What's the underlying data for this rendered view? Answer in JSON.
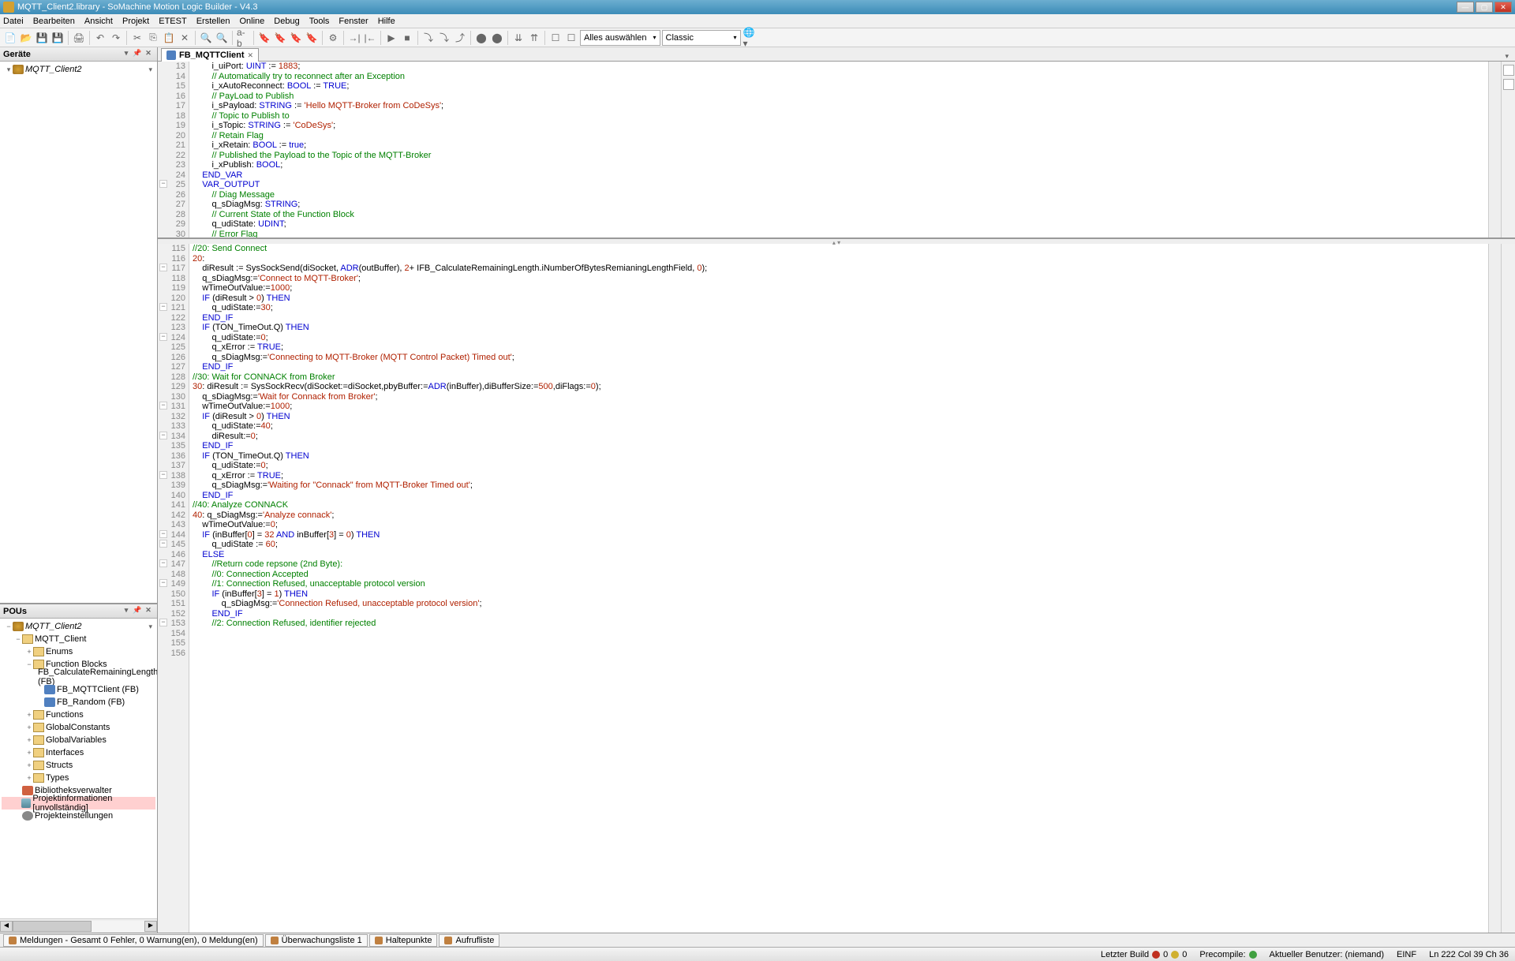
{
  "title": "MQTT_Client2.library - SoMachine Motion Logic Builder - V4.3",
  "menu": {
    "m0": "Datei",
    "m1": "Bearbeiten",
    "m2": "Ansicht",
    "m3": "Projekt",
    "m4": "ETEST",
    "m5": "Erstellen",
    "m6": "Online",
    "m7": "Debug",
    "m8": "Tools",
    "m9": "Fenster",
    "m10": "Hilfe"
  },
  "toolbar": {
    "d1": "Alles auswählen",
    "d2": "Classic"
  },
  "panels": {
    "geraete": "Geräte",
    "pous": "POUs"
  },
  "tree1": {
    "root": "MQTT_Client2"
  },
  "tree2": {
    "root": "MQTT_Client2",
    "n1": "MQTT_Client",
    "n2": "Enums",
    "n3": "Function Blocks",
    "n3a": "FB_CalculateRemainingLength (FB)",
    "n3b": "FB_MQTTClient (FB)",
    "n3c": "FB_Random (FB)",
    "n4": "Functions",
    "n5": "GlobalConstants",
    "n6": "GlobalVariables",
    "n7": "Interfaces",
    "n8": "Structs",
    "n9": "Types",
    "n10": "Bibliotheksverwalter",
    "n11": "Projektinformationen [unvollständig]",
    "n12": "Projekteinstellungen"
  },
  "tab": {
    "name": "FB_MQTTClient"
  },
  "decl": {
    "start": 13,
    "lines": [
      "        i_uiPort: UINT := 1883;",
      "        // Automatically try to reconnect after an Exception",
      "        i_xAutoReconnect: BOOL := TRUE;",
      "        // PayLoad to Publish",
      "        i_sPayload: STRING := 'Hello MQTT-Broker from CoDeSys';",
      "        // Topic to Publish to",
      "        i_sTopic: STRING := 'CoDeSys';",
      "        // Retain Flag",
      "        i_xRetain: BOOL := true;",
      "        // Published the Payload to the Topic of the MQTT-Broker",
      "        i_xPublish: BOOL;",
      "    END_VAR",
      "    VAR_OUTPUT",
      "        // Diag Message",
      "        q_sDiagMsg: STRING;",
      "        // Current State of the Function Block",
      "        q_udiState: UDINT;",
      "        // Error Flag"
    ]
  },
  "impl": {
    "start": 115,
    "lines": [
      "",
      "//20: Send Connect",
      "20:",
      "    diResult := SysSockSend(diSocket, ADR(outBuffer), 2+ IFB_CalculateRemainingLength.iNumberOfBytesRemianingLengthField, 0);",
      "    q_sDiagMsg:='Connect to MQTT-Broker';",
      "    wTimeOutValue:=1000;",
      "    IF (diResult > 0) THEN",
      "        q_udiState:=30;",
      "    END_IF",
      "    IF (TON_TimeOut.Q) THEN",
      "        q_udiState:=0;",
      "        q_xError := TRUE;",
      "        q_sDiagMsg:='Connecting to MQTT-Broker (MQTT Control Packet) Timed out';",
      "    END_IF",
      "",
      "//30: Wait for CONNACK from Broker",
      "30: diResult := SysSockRecv(diSocket:=diSocket,pbyBuffer:=ADR(inBuffer),diBufferSize:=500,diFlags:=0);",
      "    q_sDiagMsg:='Wait for Connack from Broker';",
      "    wTimeOutValue:=1000;",
      "    IF (diResult > 0) THEN",
      "        q_udiState:=40;",
      "        diResult:=0;",
      "    END_IF",
      "    IF (TON_TimeOut.Q) THEN",
      "        q_udiState:=0;",
      "        q_xError := TRUE;",
      "        q_sDiagMsg:='Waiting for \"Connack\" from MQTT-Broker Timed out';",
      "    END_IF",
      "",
      "//40: Analyze CONNACK",
      "40: q_sDiagMsg:='Analyze connack';",
      "    wTimeOutValue:=0;",
      "    IF (inBuffer[0] = 32 AND inBuffer[3] = 0) THEN",
      "        q_udiState := 60;",
      "    ELSE",
      "        //Return code repsone (2nd Byte):",
      "        //0: Connection Accepted",
      "        //1: Connection Refused, unacceptable protocol version",
      "        IF (inBuffer[3] = 1) THEN",
      "            q_sDiagMsg:='Connection Refused, unacceptable protocol version';",
      "        END_IF",
      "        //2: Connection Refused, identifier rejected"
    ],
    "fold": [
      117,
      121,
      124,
      131,
      134,
      138,
      144,
      145,
      147,
      149,
      153
    ]
  },
  "bottom": {
    "b1": "Meldungen - Gesamt 0 Fehler, 0 Warnung(en), 0 Meldung(en)",
    "b2": "Überwachungsliste 1",
    "b3": "Haltepunkte",
    "b4": "Aufrufliste"
  },
  "status": {
    "build": "Letzter Build",
    "b_e": "0",
    "b_w": "0",
    "precomp": "Precompile:",
    "user": "Aktueller Benutzer: (niemand)",
    "ins": "EINF",
    "pos": "Ln 222   Col 39   Ch 36"
  }
}
